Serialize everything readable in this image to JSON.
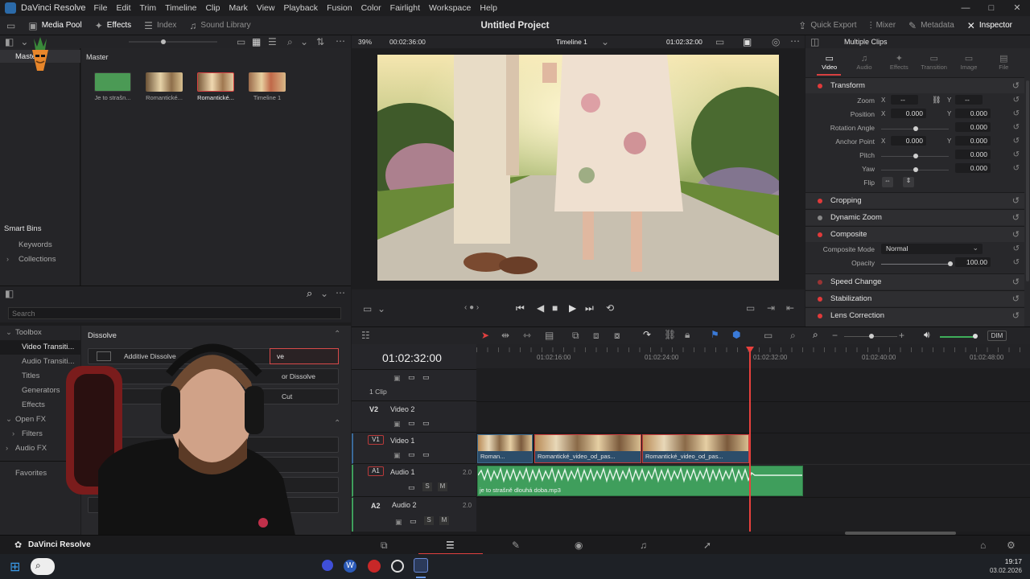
{
  "app": {
    "name": "DaVinci Resolve",
    "menu": [
      "File",
      "Edit",
      "Trim",
      "Timeline",
      "Clip",
      "Mark",
      "View",
      "Playback",
      "Fusion",
      "Color",
      "Fairlight",
      "Workspace",
      "Help"
    ],
    "window_controls": [
      "—",
      "□",
      "✕"
    ]
  },
  "toolbar": {
    "media_pool": "Media Pool",
    "effects": "Effects",
    "index": "Index",
    "sound_library": "Sound Library",
    "project_title": "Untitled Project",
    "quick_export": "Quick Export",
    "mixer": "Mixer",
    "metadata": "Metadata",
    "inspector": "Inspector"
  },
  "bins": {
    "master": "Master",
    "smart_bins": "Smart Bins",
    "keywords": "Keywords",
    "collections": "Collections"
  },
  "media_pool": {
    "header": "Master",
    "clips": [
      {
        "label": "Je to strašn...",
        "kind": "audio"
      },
      {
        "label": "Romantické...",
        "kind": "video"
      },
      {
        "label": "Romantické...",
        "kind": "video-selected"
      },
      {
        "label": "Timeline 1",
        "kind": "timeline"
      }
    ]
  },
  "effects": {
    "search_placeholder": "Search",
    "tree": [
      {
        "label": "Toolbox",
        "level": 0,
        "expanded": true
      },
      {
        "label": "Video Transiti...",
        "level": 1,
        "selected": true
      },
      {
        "label": "Audio Transiti...",
        "level": 1
      },
      {
        "label": "Titles",
        "level": 1
      },
      {
        "label": "Generators",
        "level": 1
      },
      {
        "label": "Effects",
        "level": 1
      },
      {
        "label": "Open FX",
        "level": 0,
        "expanded": true
      },
      {
        "label": "Filters",
        "level": 1
      },
      {
        "label": "Audio FX",
        "level": 0
      }
    ],
    "favorites": "Favorites",
    "group_title": "Dissolve",
    "items": [
      {
        "label": "Additive Dissolve"
      },
      {
        "label": "ve"
      },
      {
        "label": "or Dissolve"
      },
      {
        "label": "Cut"
      }
    ]
  },
  "viewer": {
    "zoom": "39%",
    "source_timecode": "00:02:36:00",
    "timeline_name": "Timeline 1",
    "record_timecode": "01:02:32:00"
  },
  "inspector": {
    "title": "Multiple Clips",
    "tabs": [
      "Video",
      "Audio",
      "Effects",
      "Transition",
      "Image",
      "File"
    ],
    "transform": {
      "title": "Transform",
      "zoom_label": "Zoom",
      "zoom_x": "--",
      "zoom_y": "--",
      "position_label": "Position",
      "position_x": "0.000",
      "position_y": "0.000",
      "rotation_label": "Rotation Angle",
      "rotation": "0.000",
      "anchor_label": "Anchor Point",
      "anchor_x": "0.000",
      "anchor_y": "0.000",
      "pitch_label": "Pitch",
      "pitch": "0.000",
      "yaw_label": "Yaw",
      "yaw": "0.000",
      "flip_label": "Flip",
      "x": "X",
      "y": "Y"
    },
    "cropping": "Cropping",
    "dynamic_zoom": "Dynamic Zoom",
    "composite": {
      "title": "Composite",
      "mode_label": "Composite Mode",
      "mode": "Normal",
      "opacity_label": "Opacity",
      "opacity": "100.00"
    },
    "speed_change": "Speed Change",
    "stabilization": "Stabilization",
    "lens_correction": "Lens Correction"
  },
  "timeline": {
    "timecode": "01:02:32:00",
    "dim": "DIM",
    "ruler": [
      "01:02:16:00",
      "01:02:24:00",
      "01:02:32:00",
      "01:02:40:00",
      "01:02:48:00"
    ],
    "tracks": [
      {
        "id": "",
        "name": "",
        "count": "1 Clip"
      },
      {
        "id": "V2",
        "name": "Video 2"
      },
      {
        "id": "V1",
        "name": "Video 1"
      },
      {
        "id": "A1",
        "name": "Audio 1",
        "channels": "2.0"
      },
      {
        "id": "A2",
        "name": "Audio 2",
        "channels": "2.0"
      }
    ],
    "video_clips": [
      {
        "name": "Roman..."
      },
      {
        "name": "Romantické_video_od_pas..."
      },
      {
        "name": "Romantické_video_od_pas..."
      }
    ],
    "audio_clip": "je to strašně dlouhá doba.mp3",
    "solo": "S",
    "mute": "M"
  },
  "pagebar": {
    "app": "DaVinci Resolve"
  },
  "taskbar": {
    "time": "19:17",
    "date": "03.02.2026"
  },
  "colors": {
    "accent_red": "#e13a3a",
    "clip_blue": "#2c4d6a",
    "audio_green": "#3f9e5c",
    "playhead": "#e8403c"
  }
}
